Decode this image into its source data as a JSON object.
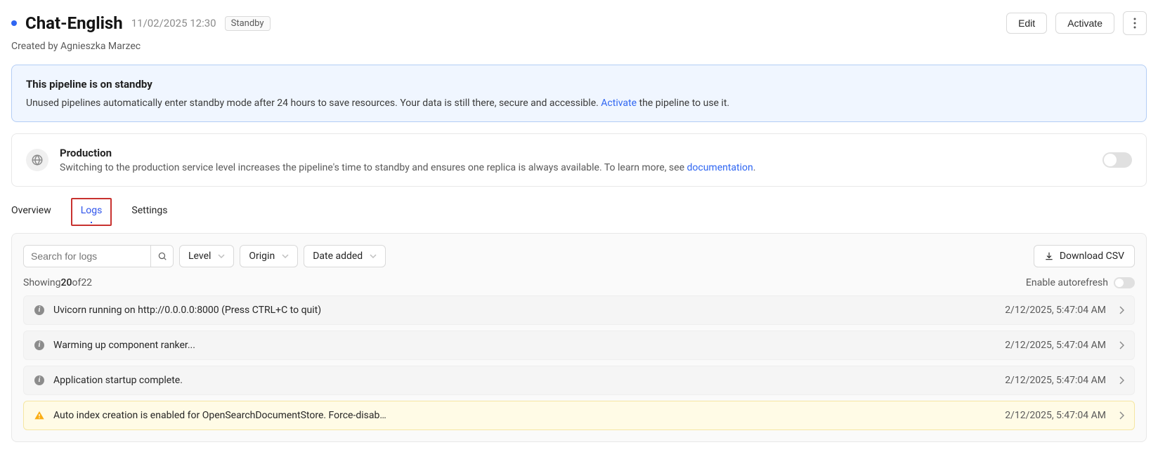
{
  "header": {
    "title": "Chat-English",
    "timestamp": "11/02/2025 12:30",
    "status_badge": "Standby",
    "edit_label": "Edit",
    "activate_label": "Activate",
    "created_by": "Created by Agnieszka Marzec"
  },
  "banner": {
    "title": "This pipeline is on standby",
    "body_prefix": "Unused pipelines automatically enter standby mode after 24 hours to save resources. Your data is still there, secure and accessible. ",
    "activate_link": "Activate",
    "body_suffix": " the pipeline to use it."
  },
  "production": {
    "title": "Production",
    "desc_prefix": "Switching to the production service level increases the pipeline's time to standby and ensures one replica is always available. To learn more, see ",
    "doc_link": "documentation",
    "desc_suffix": "."
  },
  "tabs": {
    "overview": "Overview",
    "logs": "Logs",
    "settings": "Settings"
  },
  "filters": {
    "search_placeholder": "Search for logs",
    "level": "Level",
    "origin": "Origin",
    "date_added": "Date added",
    "download": "Download CSV"
  },
  "meta": {
    "showing": "Showing ",
    "count": "20",
    "of": " of ",
    "total": "22",
    "autorefresh": "Enable autorefresh"
  },
  "logs": [
    {
      "level": "info",
      "msg": "Uvicorn running on http://0.0.0.0:8000 (Press CTRL+C to quit)",
      "time": "2/12/2025, 5:47:04 AM"
    },
    {
      "level": "info",
      "msg": "Warming up component ranker...",
      "time": "2/12/2025, 5:47:04 AM"
    },
    {
      "level": "info",
      "msg": "Application startup complete.",
      "time": "2/12/2025, 5:47:04 AM"
    },
    {
      "level": "warn",
      "msg": "Auto index creation is enabled for OpenSearchDocumentStore. Force-disab…",
      "time": "2/12/2025, 5:47:04 AM"
    }
  ]
}
